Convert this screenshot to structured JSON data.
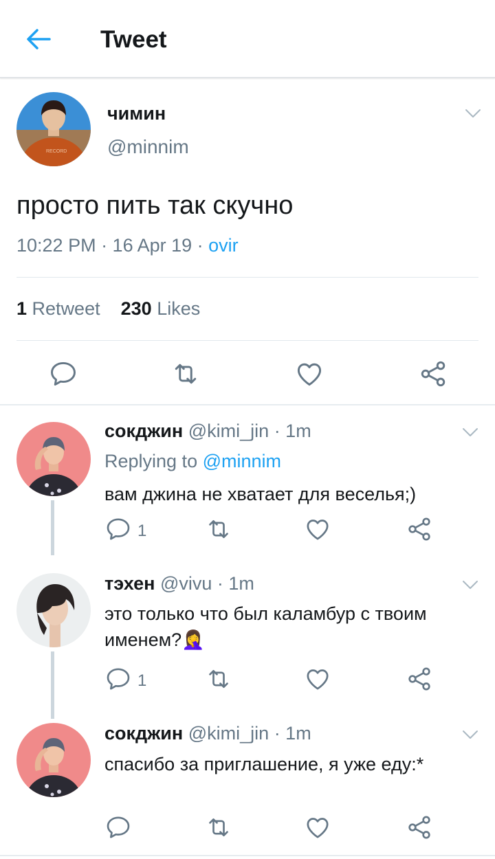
{
  "header": {
    "title": "Tweet"
  },
  "tweet": {
    "name": "чимин",
    "handle": "@minnim",
    "text": "просто пить так скучно",
    "time": "10:22 PM · 16 Apr 19 · ",
    "source": "ovir",
    "retweet_count": "1",
    "retweet_label": "Retweet",
    "like_count": "230",
    "like_label": "Likes",
    "avatar_shirt_text": "RECORD"
  },
  "replies": [
    {
      "name": "сокджин",
      "handle": "@kimi_jin",
      "time": "· 1m",
      "replying_prefix": "Replying to ",
      "replying_to": "@minnim",
      "text": "вам джина не хватает для веселья;)",
      "reply_count": "1"
    },
    {
      "name": "тэхен",
      "handle": "@vivu",
      "time": "· 1m",
      "text": "это только что был каламбур с твоим именем?",
      "emoji": "🤦‍♀️",
      "reply_count": "1"
    },
    {
      "name": "сокджин",
      "handle": "@kimi_jin",
      "time": "· 1m",
      "text": "спасибо за приглашение, я уже еду:*",
      "reply_count": ""
    }
  ],
  "colors": {
    "accent": "#1da1f2",
    "secondary": "#657786",
    "text": "#14171a",
    "icon": "#657786"
  },
  "icons": [
    "back-arrow-icon",
    "chevron-down-icon",
    "reply-icon",
    "retweet-icon",
    "like-icon",
    "share-icon"
  ]
}
